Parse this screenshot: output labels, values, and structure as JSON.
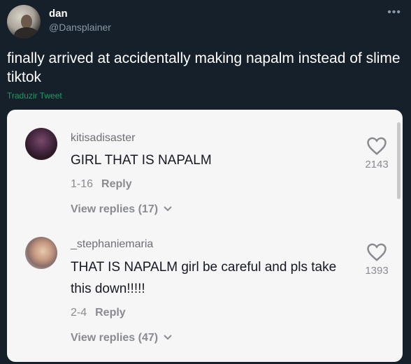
{
  "tweet": {
    "display_name": "dan",
    "handle": "@Dansplainer",
    "text": "finally arrived at accidentally making napalm instead of slime tiktok",
    "translate_label": "Traduzir Tweet",
    "more_icon": "more-horizontal-icon"
  },
  "comments": [
    {
      "username": "kitisadisaster",
      "text": "GIRL THAT IS NAPALM",
      "date": "1-16",
      "reply_label": "Reply",
      "view_replies": "View replies (17)",
      "likes": "2143",
      "heart_icon": "heart-icon"
    },
    {
      "username": "_stephaniemaria",
      "text": "THAT IS NAPALM girl be careful and pls take this down!!!!!",
      "date": "2-4",
      "reply_label": "Reply",
      "view_replies": "View replies (47)",
      "likes": "1393",
      "heart_icon": "heart-icon"
    }
  ]
}
